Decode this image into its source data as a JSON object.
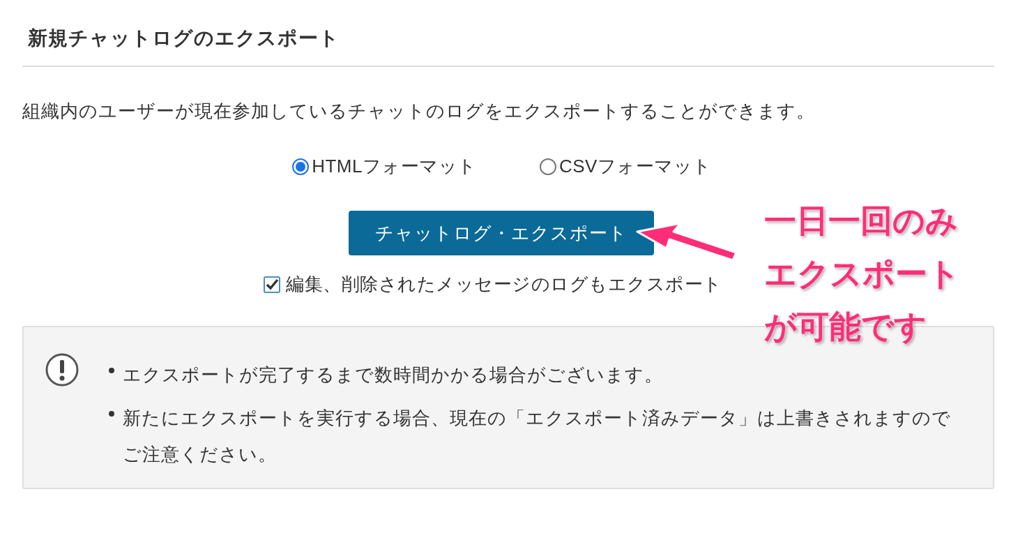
{
  "section": {
    "title": "新規チャットログのエクスポート"
  },
  "description": "組織内のユーザーが現在参加しているチャットのログをエクスポートすることができます。",
  "formats": [
    {
      "label": "HTMLフォーマット",
      "selected": true
    },
    {
      "label": "CSVフォーマット",
      "selected": false
    }
  ],
  "export_button": "チャットログ・エクスポート",
  "include_edited": {
    "label": "編集、削除されたメッセージのログもエクスポート",
    "checked": true
  },
  "notice": {
    "items": [
      "エクスポートが完了するまで数時間かかる場合がございます。",
      "新たにエクスポートを実行する場合、現在の「エクスポート済みデータ」は上書きされますのでご注意ください。"
    ]
  },
  "annotation": {
    "lines": [
      "一日一回のみ",
      "エクスポート",
      "が可能です"
    ]
  }
}
